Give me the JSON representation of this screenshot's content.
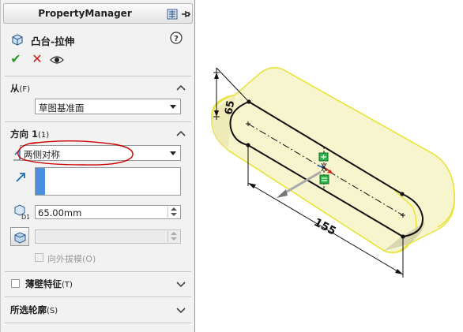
{
  "panel": {
    "title": "PropertyManager",
    "feature_name": "凸台-拉伸",
    "help_icon": "help-icon",
    "actions": {
      "ok": {
        "icon": "checkmark-icon",
        "color": "#2a9a2a"
      },
      "cancel": {
        "icon": "x-icon",
        "color": "#d01818"
      },
      "preview": {
        "icon": "eye-icon"
      }
    }
  },
  "section_from": {
    "title": "从",
    "hotkey": "(F)",
    "selected": "草图基准面"
  },
  "section_direction1": {
    "title": "方向 1",
    "hotkey": "(1)",
    "end_condition": "两侧对称",
    "depth": "65.00mm",
    "draft_label": "向外拔模",
    "draft_hotkey": "(O)",
    "annotation_color": "#cc0000"
  },
  "section_thin": {
    "title": "薄壁特征",
    "hotkey": "(T)"
  },
  "section_contours": {
    "title": "所选轮廓",
    "hotkey": "(S)"
  },
  "viewport": {
    "dimensions": {
      "depth_label": "65",
      "length_label": "155"
    },
    "colors": {
      "preview_fill": "#f6f3c6",
      "preview_edge": "#e8e43c",
      "sketch": "#111111",
      "handle_green": "#29b34a",
      "arrow_red": "#d32020"
    }
  }
}
